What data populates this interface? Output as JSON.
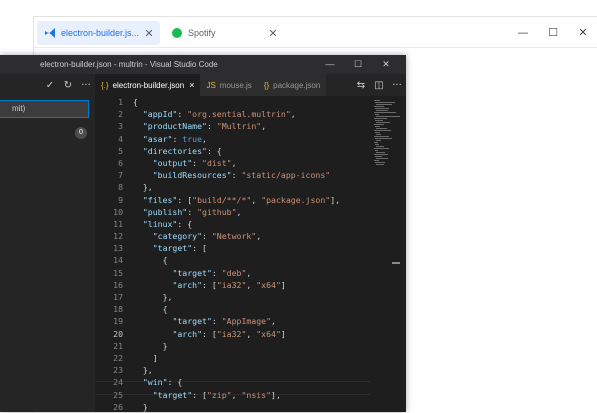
{
  "outer": {
    "tabs": [
      {
        "label": "electron-builder.js...",
        "close": "✕",
        "icon": "vscode-icon"
      },
      {
        "label": "Spotify",
        "close": "✕",
        "icon": "spotify-icon"
      }
    ],
    "controls": {
      "minimize": "—",
      "maximize": "☐",
      "close": "✕"
    }
  },
  "vscode": {
    "title": "electron-builder.json - multrin - Visual Studio Code",
    "controls": {
      "minimize": "—",
      "maximize": "☐",
      "close": "✕"
    },
    "sidebar": {
      "toolbar": {
        "commit": "✓",
        "refresh": "↻",
        "more": "···"
      },
      "input_value": "mit)",
      "badge": "0"
    },
    "tabs": [
      {
        "label": "electron-builder.json",
        "icon": "{.}",
        "close": "×"
      },
      {
        "label": "mouse.js",
        "icon": "JS",
        "close": ""
      },
      {
        "label": "package.json",
        "icon": "{}",
        "close": ""
      }
    ],
    "tab_actions": {
      "compare": "⇆",
      "split": "◫",
      "more": "···"
    },
    "line_numbers": [
      "1",
      "2",
      "3",
      "4",
      "5",
      "6",
      "7",
      "8",
      "9",
      "10",
      "11",
      "12",
      "13",
      "14",
      "15",
      "16",
      "17",
      "18",
      "19",
      "20",
      "21",
      "22",
      "23",
      "24",
      "25",
      "26"
    ]
  }
}
